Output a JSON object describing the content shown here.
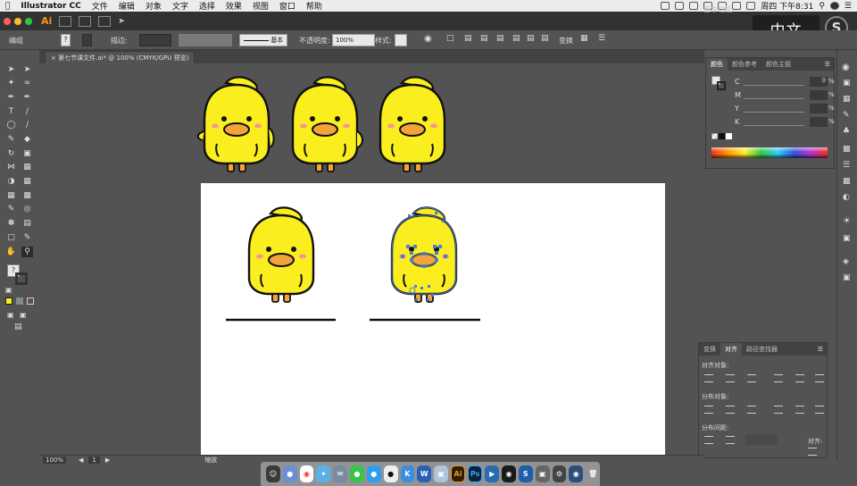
{
  "menubar": {
    "app_name": "Illustrator CC",
    "menus": [
      "文件",
      "编辑",
      "对象",
      "文字",
      "选择",
      "效果",
      "视图",
      "窗口",
      "帮助"
    ],
    "clock": "周四 下午8:31"
  },
  "appbar": {
    "logo": "Ai",
    "icon_br": "Br",
    "workspace": "基本功能",
    "language_badge": "中文",
    "brand_badge": "S"
  },
  "control_bar": {
    "group_label": "编组",
    "stroke_label": "描边:",
    "stroke_style": "基本",
    "opacity_label": "不透明度:",
    "opacity_value": "100%",
    "style_label": "样式:",
    "transform_label": "变换"
  },
  "document": {
    "tab_title": "第七节课文件.ai* @ 100% (CMYK/GPU 预览)"
  },
  "color_panel": {
    "tabs": [
      "颜色",
      "颜色参考",
      "颜色主题"
    ],
    "channels": [
      {
        "name": "C",
        "value": "0",
        "unit": "%"
      },
      {
        "name": "M",
        "value": "",
        "unit": "%"
      },
      {
        "name": "Y",
        "value": "",
        "unit": "%"
      },
      {
        "name": "K",
        "value": "",
        "unit": "%"
      }
    ]
  },
  "align_panel": {
    "tabs": [
      "变换",
      "对齐",
      "路径查找器"
    ],
    "align_objects": "对齐对象:",
    "distribute_objects": "分布对象:",
    "distribute_spacing": "分布间距:",
    "align_to": "对齐:"
  },
  "status_bar": {
    "zoom": "100%",
    "page": "1",
    "tool": "缩放"
  },
  "dock": {
    "apps": [
      {
        "label": "Ai",
        "color": "#2d1e05"
      },
      {
        "label": "Ps",
        "color": "#0e2238"
      },
      {
        "label": "K",
        "color": "#3b8ee0"
      },
      {
        "label": "W",
        "color": "#2b5fb3"
      }
    ]
  },
  "colors": {
    "chick_yellow": "#fbee1f",
    "beak_orange": "#f2a33a",
    "cheek_pink": "#f59a8b",
    "selection_blue": "#4a7bd6"
  }
}
